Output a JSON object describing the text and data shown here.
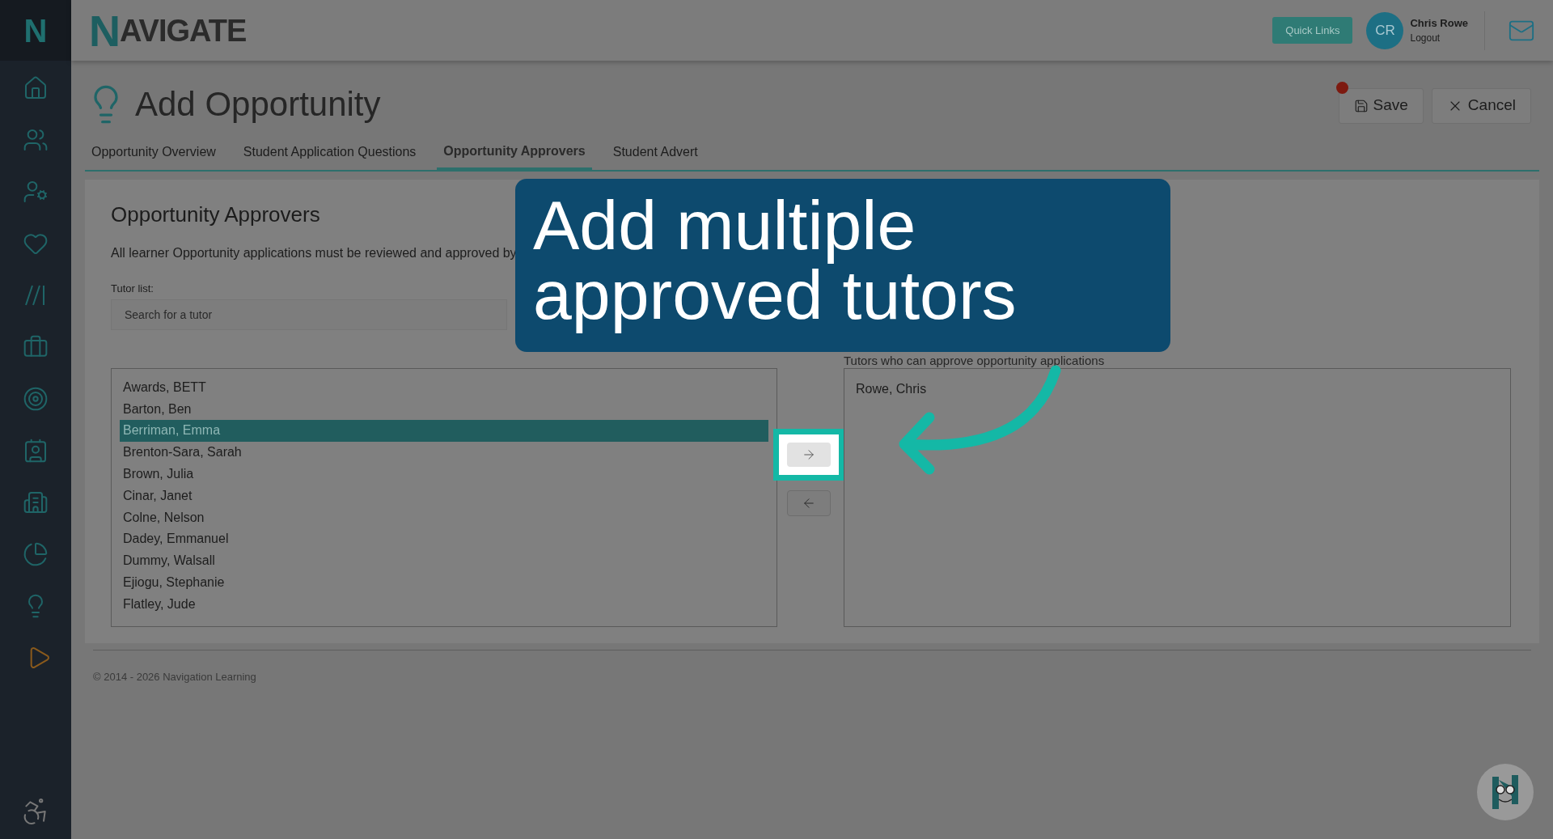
{
  "sidebar": {
    "logo": "N"
  },
  "header": {
    "logo": "NAVIGATE",
    "quick_links": "Quick Links",
    "user": {
      "initials": "CR",
      "name": "Chris Rowe",
      "logout": "Logout"
    }
  },
  "page": {
    "title": "Add Opportunity",
    "unsaved": true,
    "save": "Save",
    "cancel": "Cancel"
  },
  "tabs": [
    {
      "label": "Opportunity Overview",
      "selected": false
    },
    {
      "label": "Student Application Questions",
      "selected": false
    },
    {
      "label": "Opportunity Approvers",
      "selected": true
    },
    {
      "label": "Student Advert",
      "selected": false
    }
  ],
  "section": {
    "heading": "Opportunity Approvers",
    "description": "All learner Opportunity applications must be reviewed and approved by",
    "tutor_label": "Tutor list:",
    "search": {
      "placeholder": "Search for a tutor"
    },
    "available": [
      {
        "name": "Awards, BETT",
        "selected": false
      },
      {
        "name": "Barton, Ben",
        "selected": false
      },
      {
        "name": "Berriman, Emma",
        "selected": true
      },
      {
        "name": "Brenton-Sara, Sarah",
        "selected": false
      },
      {
        "name": "Brown, Julia",
        "selected": false
      },
      {
        "name": "Cinar, Janet",
        "selected": false
      },
      {
        "name": "Colne, Nelson",
        "selected": false
      },
      {
        "name": "Dadey, Emmanuel",
        "selected": false
      },
      {
        "name": "Dummy, Walsall",
        "selected": false
      },
      {
        "name": "Ejiogu, Stephanie",
        "selected": false
      },
      {
        "name": "Flatley, Jude",
        "selected": false
      }
    ],
    "approvers_label": "Tutors who can approve opportunity applications",
    "approvers": [
      "Rowe, Chris"
    ]
  },
  "footer": "© 2014 - 2026 Navigation Learning",
  "callout": {
    "text": "Add multiple approved tutors"
  }
}
